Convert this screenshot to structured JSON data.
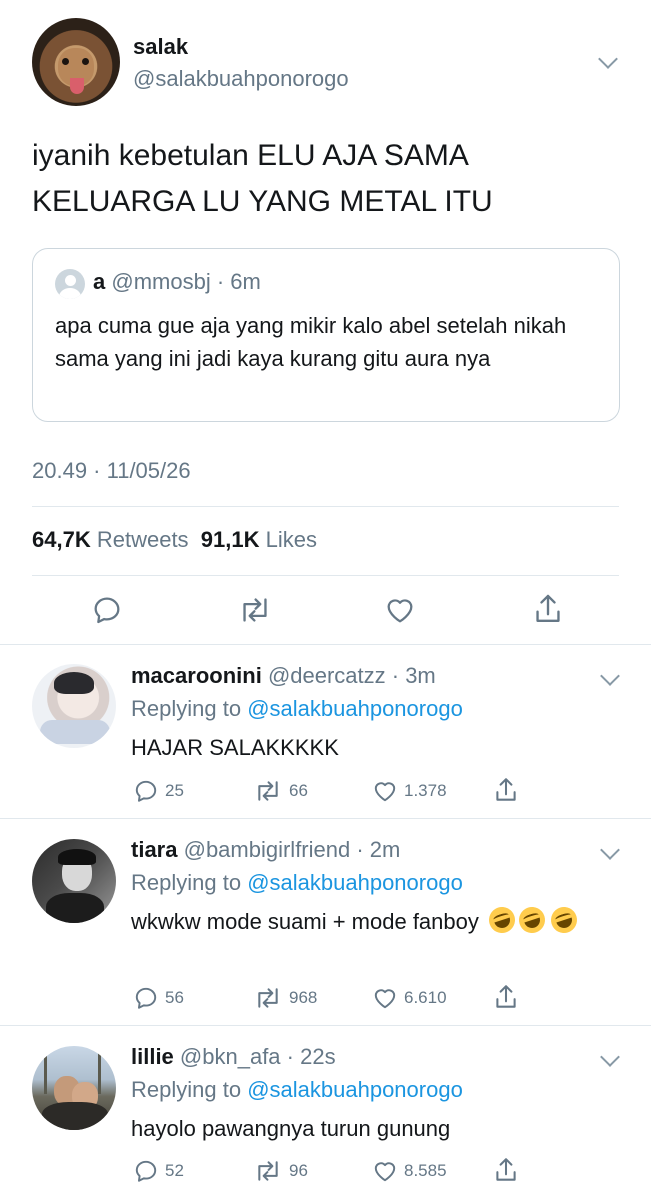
{
  "main": {
    "name": "salak",
    "handle": "@salakbuahponorogo",
    "text": "iyanih kebetulan ELU AJA SAMA KELUARGA LU YANG METAL ITU",
    "quote": {
      "name": "a",
      "handle_time": "@mmosbj · 6m",
      "text": "apa cuma gue aja yang mikir kalo abel setelah nikah sama yang ini jadi kaya kurang gitu aura nya"
    },
    "timestamp": "20.49 · 11/05/26",
    "retweets_count": "64,7K",
    "retweets_label": "Retweets",
    "likes_count": "91,1K",
    "likes_label": "Likes"
  },
  "icons": {
    "reply": "reply-icon",
    "retweet": "retweet-icon",
    "like": "heart-icon",
    "share": "share-icon",
    "menu": "chevron-down-icon"
  },
  "colors": {
    "link": "#1b95e0",
    "secondary": "#657786",
    "text": "#14171a",
    "divider": "#e1e8ed"
  },
  "replies": [
    {
      "name": "macaroonini",
      "handle_time": "@deercatzz · 3m",
      "replying_label": "Replying to",
      "replying_to": "@salakbuahponorogo",
      "text": "HAJAR SALAKKKKK",
      "replies": "25",
      "retweets": "66",
      "likes": "1.378"
    },
    {
      "name": "tiara",
      "handle_time": "@bambigirlfriend · 2m",
      "replying_label": "Replying to",
      "replying_to": "@salakbuahponorogo",
      "text": "wkwkw mode suami + mode fanboy",
      "replies": "56",
      "retweets": "968",
      "likes": "6.610"
    },
    {
      "name": "lillie",
      "handle_time": "@bkn_afa · 22s",
      "replying_label": "Replying to",
      "replying_to": "@salakbuahponorogo",
      "text": "hayolo pawangnya turun gunung",
      "replies": "52",
      "retweets": "96",
      "likes": "8.585"
    }
  ]
}
